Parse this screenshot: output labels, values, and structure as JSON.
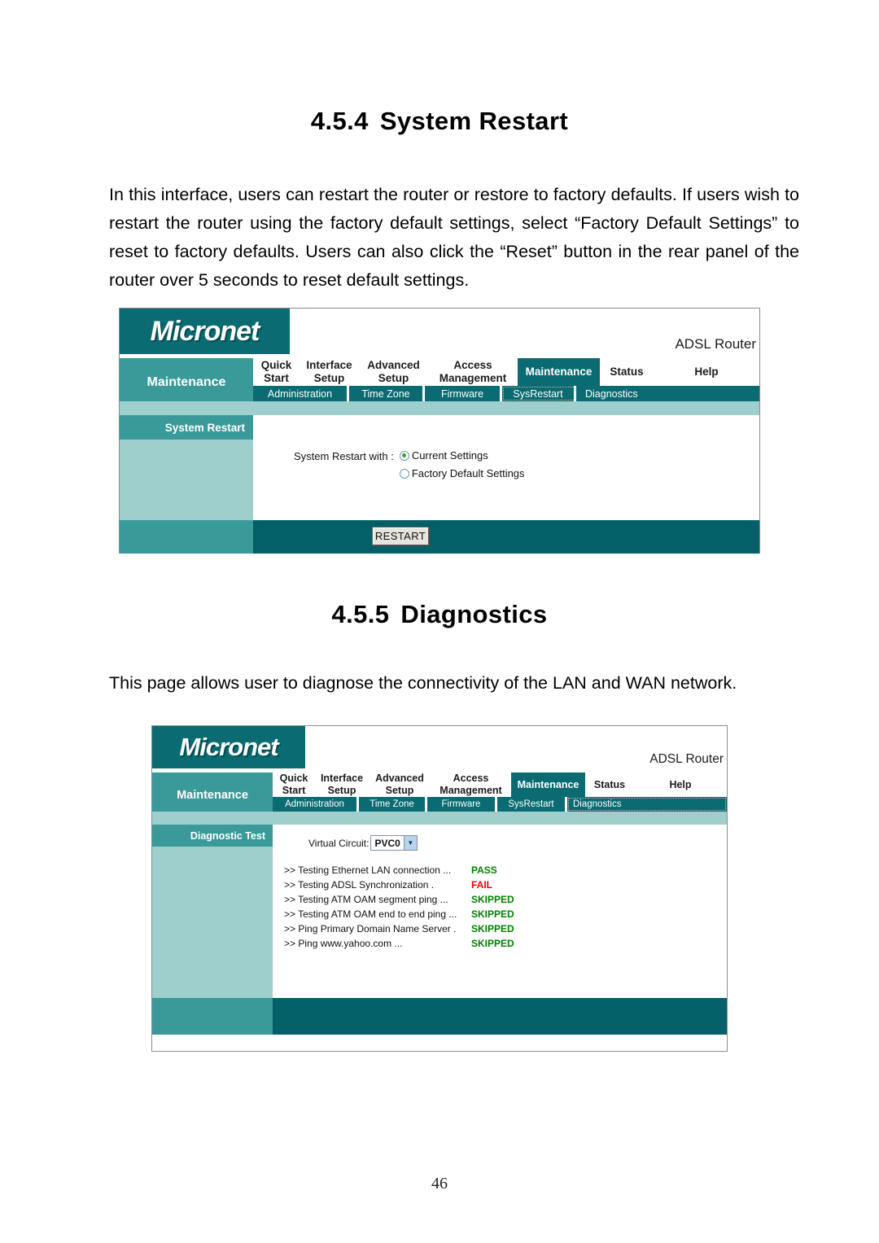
{
  "document": {
    "page_number": "46",
    "sections": [
      {
        "number": "4.5.4",
        "title": "System Restart",
        "body": "In this interface, users can restart the router or restore to factory defaults. If users wish to restart the router using the factory default settings, select “Factory Default Settings” to reset to factory defaults. Users can also click the “Reset” button in the rear panel of the router over 5 seconds to reset default settings."
      },
      {
        "number": "4.5.5",
        "title": "Diagnostics",
        "body": "This page allows user to diagnose the connectivity of the LAN and WAN network."
      }
    ]
  },
  "router_ui": {
    "brand": "Micronet",
    "model": "ADSL Router",
    "section_label": "Maintenance",
    "main_nav": [
      {
        "label": "Quick\nStart",
        "active": false
      },
      {
        "label": "Interface\nSetup",
        "active": false
      },
      {
        "label": "Advanced\nSetup",
        "active": false
      },
      {
        "label": "Access\nManagement",
        "active": false
      },
      {
        "label": "Maintenance",
        "active": true
      },
      {
        "label": "Status",
        "active": false
      },
      {
        "label": "Help",
        "active": false
      }
    ],
    "sub_nav_sysrestart": [
      {
        "label": "Administration",
        "active": false
      },
      {
        "label": "Time Zone",
        "active": false
      },
      {
        "label": "Firmware",
        "active": false
      },
      {
        "label": "SysRestart",
        "active": true
      },
      {
        "label": "Diagnostics",
        "active": false
      }
    ],
    "sub_nav_diagnostics": [
      {
        "label": "Administration",
        "active": false
      },
      {
        "label": "Time Zone",
        "active": false
      },
      {
        "label": "Firmware",
        "active": false
      },
      {
        "label": "SysRestart",
        "active": false
      },
      {
        "label": "Diagnostics",
        "active": true
      }
    ]
  },
  "system_restart_screen": {
    "panel_title": "System Restart",
    "field_label": "System Restart with :",
    "options": [
      {
        "label": "Current Settings",
        "selected": true
      },
      {
        "label": "Factory Default Settings",
        "selected": false
      }
    ],
    "restart_button": "RESTART"
  },
  "diagnostics_screen": {
    "panel_title": "Diagnostic Test",
    "virtual_circuit_label": "Virtual Circuit:",
    "virtual_circuit_value": "PVC0",
    "tests": [
      {
        "name": ">> Testing Ethernet LAN connection ...",
        "status": "PASS",
        "color": "#008000"
      },
      {
        "name": ">> Testing ADSL Synchronization .",
        "status": "FAIL",
        "color": "#ee0000"
      },
      {
        "name": ">> Testing ATM OAM segment ping ...",
        "status": "SKIPPED",
        "color": "#008000"
      },
      {
        "name": ">> Testing ATM OAM end to end ping ...",
        "status": "SKIPPED",
        "color": "#008000"
      },
      {
        "name": ">> Ping Primary Domain Name Server .",
        "status": "SKIPPED",
        "color": "#008000"
      },
      {
        "name": ">> Ping www.yahoo.com ...",
        "status": "SKIPPED",
        "color": "#008000"
      }
    ]
  },
  "colors": {
    "brand_dark_teal": "#0a6b72",
    "mid_teal": "#3a9a9a",
    "light_teal": "#9ecfcc",
    "footer_teal": "#046068"
  }
}
